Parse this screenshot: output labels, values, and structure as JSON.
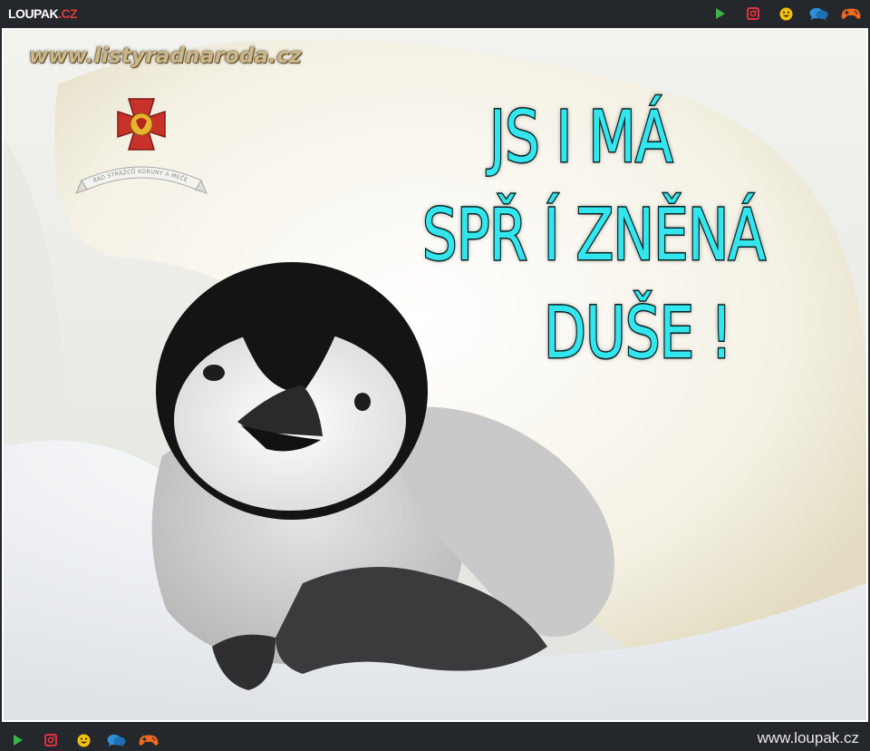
{
  "header": {
    "logo_main": "LOUPAK",
    "logo_suffix": ".CZ",
    "icons": [
      "play-icon",
      "instagram-icon",
      "smiley-icon",
      "chat-icon",
      "gamepad-icon"
    ]
  },
  "image": {
    "watermark": "www.listyradnaroda.cz",
    "seal_text": "ŘÁD STRÁŽCŮ KORUNY A MEČE",
    "caption_lines": [
      "JS I   MÁ",
      "SPŘ Í ZNĚNÁ",
      "DUŠE !"
    ]
  },
  "footer": {
    "icons": [
      "play-icon",
      "instagram-icon",
      "smiley-icon",
      "chat-icon",
      "gamepad-icon"
    ],
    "site": "www.loupak.cz"
  },
  "colors": {
    "bar_bg": "#24272b",
    "caption": "#33e6ee",
    "play": "#3ab54a",
    "instagram": "#e0313f",
    "smiley": "#f4c20d",
    "chat": "#2f8fd8",
    "gamepad": "#f26b1d"
  }
}
